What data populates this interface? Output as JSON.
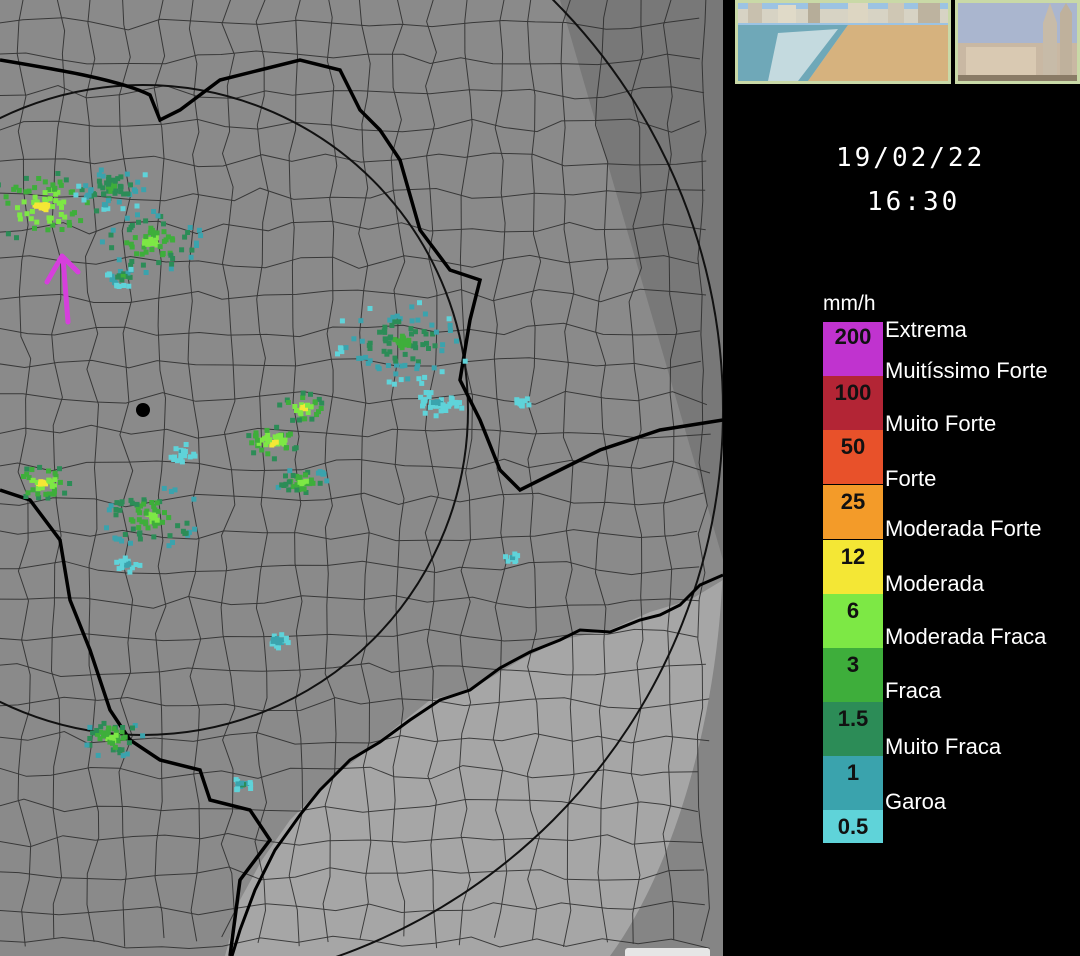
{
  "map": {
    "marker_icon": "arrow-up-icon",
    "marker_color": "#d63fdc",
    "background_color": "#8a8a8a",
    "sea_color": "#a9a9a9"
  },
  "sidebar": {
    "date": "19/02/22",
    "time": "16:30",
    "thumbnails": [
      "beach-photo",
      "cathedral-photo"
    ],
    "legend": {
      "unit": "mm/h",
      "swatches": [
        {
          "value": "200",
          "color": "#c033cf"
        },
        {
          "value": "100",
          "color": "#b32535"
        },
        {
          "value": "50",
          "color": "#e8512a"
        },
        {
          "value": "25",
          "color": "#f39b29"
        },
        {
          "value": "12",
          "color": "#f4e735"
        },
        {
          "value": "6",
          "color": "#7de845"
        },
        {
          "value": "3",
          "color": "#3eae3b"
        },
        {
          "value": "1.5",
          "color": "#2c8c57"
        },
        {
          "value": "1",
          "color": "#3aa3ad"
        },
        {
          "value": "0.5",
          "color": "#5fd3d9"
        }
      ],
      "levels": [
        "Extrema",
        "Muitíssimo Forte",
        "Muito Forte",
        "Forte",
        "Moderada Forte",
        "Moderada",
        "Moderada Fraca",
        "Fraca",
        "Muito Fraca",
        "Garoa"
      ]
    }
  }
}
